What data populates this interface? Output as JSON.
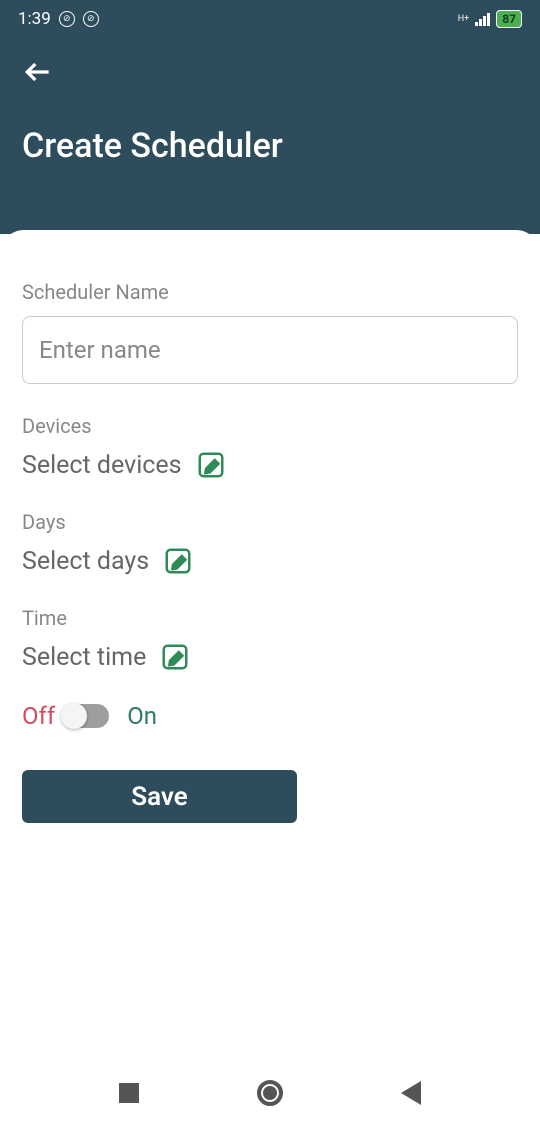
{
  "statusBar": {
    "time": "1:39",
    "batteryLevel": "87"
  },
  "header": {
    "title": "Create Scheduler"
  },
  "form": {
    "nameLabel": "Scheduler Name",
    "namePlaceholder": "Enter name",
    "nameValue": "",
    "devicesLabel": "Devices",
    "devicesSelectText": "Select devices",
    "daysLabel": "Days",
    "daysSelectText": "Select days",
    "timeLabel": "Time",
    "timeSelectText": "Select time",
    "offLabel": "Off",
    "onLabel": "On",
    "toggleState": "off",
    "saveButton": "Save"
  }
}
